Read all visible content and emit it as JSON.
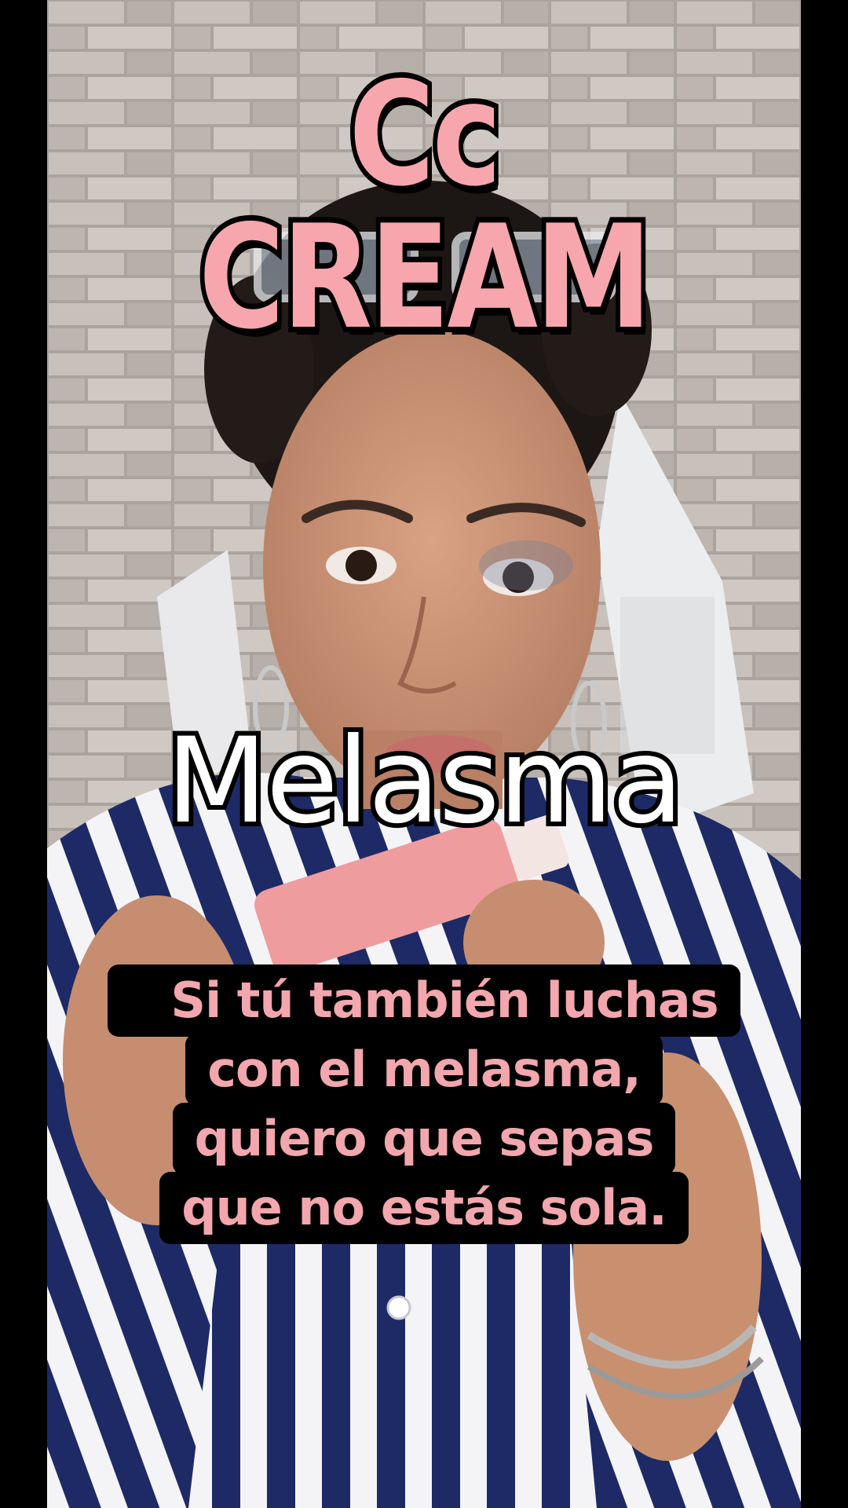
{
  "video": {
    "title_overlay": "Cc CREAM",
    "keyword_overlay": "Melasma",
    "caption_lines": [
      "Si tú también luchas",
      "con el melasma,",
      "quiero que sepas",
      "que no estás sola."
    ]
  },
  "colors": {
    "title_pink": "#f7a6ad",
    "caption_pink": "#f2a6ad",
    "caption_bg": "#000000",
    "wall": "#a9a19b",
    "shirt_stripe_dark": "#1d2a66",
    "shirt_stripe_light": "#f4f4f7"
  }
}
